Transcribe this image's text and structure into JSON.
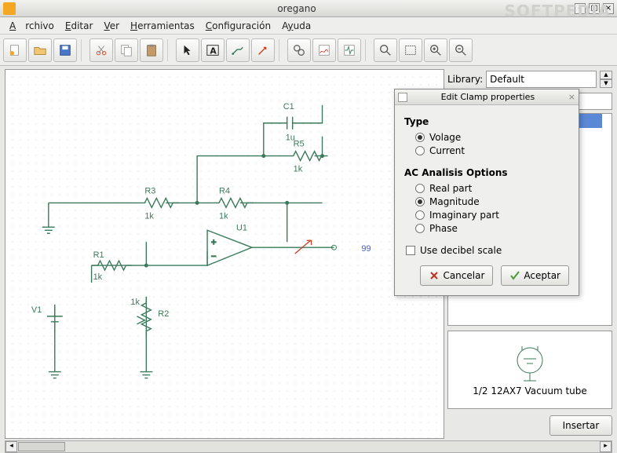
{
  "window": {
    "title": "oregano",
    "watermark": "SOFTPEDIA"
  },
  "menu": {
    "archivo": "Archivo",
    "editar": "Editar",
    "ver": "Ver",
    "herramientas": "Herramientas",
    "configuracion": "Configuración",
    "ayuda": "Ayuda"
  },
  "toolbar_icons": [
    "new",
    "open",
    "save",
    "cut",
    "copy",
    "paste",
    "arrow",
    "text",
    "wire",
    "clamp",
    "gears",
    "graph",
    "sim",
    "zoomfit",
    "zoomrect",
    "zoomin",
    "zoomout"
  ],
  "library": {
    "label": "Library:",
    "value": "Default"
  },
  "preview_part": "1/2 12AX7 Vacuum tube",
  "insert_btn": "Insertar",
  "schematic": {
    "components": {
      "C1": {
        "label": "C1",
        "value": "1u"
      },
      "R1": {
        "label": "R1",
        "value": "1k"
      },
      "R2": {
        "label": "R2",
        "value": "1k"
      },
      "R3": {
        "label": "R3",
        "value": "1k"
      },
      "R4": {
        "label": "R4",
        "value": "1k"
      },
      "R5": {
        "label": "R5",
        "value": "1k"
      },
      "U1": {
        "label": "U1"
      },
      "V1": {
        "label": "V1"
      }
    },
    "netlabel": "99"
  },
  "dialog": {
    "title": "Edit Clamp properties",
    "type_label": "Type",
    "type_options": [
      "Volage",
      "Current"
    ],
    "type_selected": "Volage",
    "ac_label": "AC Analisis Options",
    "ac_options": [
      "Real part",
      "Magnitude",
      "Imaginary part",
      "Phase"
    ],
    "ac_selected": "Magnitude",
    "decibel_label": "Use decibel scale",
    "decibel_checked": false,
    "cancel": "Cancelar",
    "accept": "Aceptar"
  }
}
